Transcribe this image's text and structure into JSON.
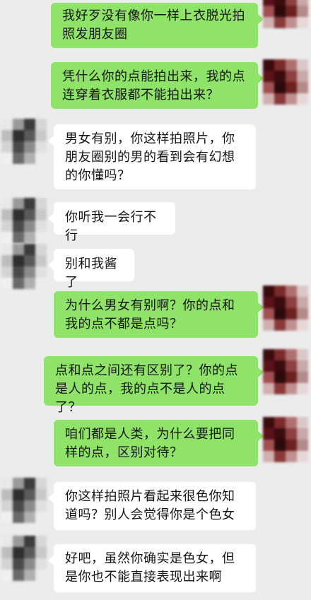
{
  "messages": [
    {
      "side": "right",
      "text": "我好歹没有像你一样上衣脱光拍照发朋友圈"
    },
    {
      "side": "right",
      "text": "凭什么你的点能拍出来，我的点连穿着衣服都不能拍出来？"
    },
    {
      "side": "left",
      "text": "男女有别，你这样拍照片，你朋友圈别的男的看到会有幻想的你懂吗？"
    },
    {
      "side": "left",
      "text": "你听我一会行不行"
    },
    {
      "side": "left",
      "text": "别和我酱了"
    },
    {
      "side": "right",
      "text": "为什么男女有别啊？你的点和我的点不都是点吗？"
    },
    {
      "side": "right",
      "text": "点和点之间还有区别了？你的点是人的点，我的点不是人的点了？"
    },
    {
      "side": "right",
      "text": "咱们都是人类，为什么要把同样的点，区别对待？"
    },
    {
      "side": "left",
      "text": "你这样拍照片看起来很色你知道吗？别人会觉得你是个色女"
    },
    {
      "side": "left",
      "text": "好吧，虽然你确实是色女，但是你也不能直接表现出来啊"
    }
  ],
  "colors": {
    "background": "#ececec",
    "sent_bubble": "#8fe368",
    "received_bubble": "#ffffff",
    "text": "#141414"
  }
}
